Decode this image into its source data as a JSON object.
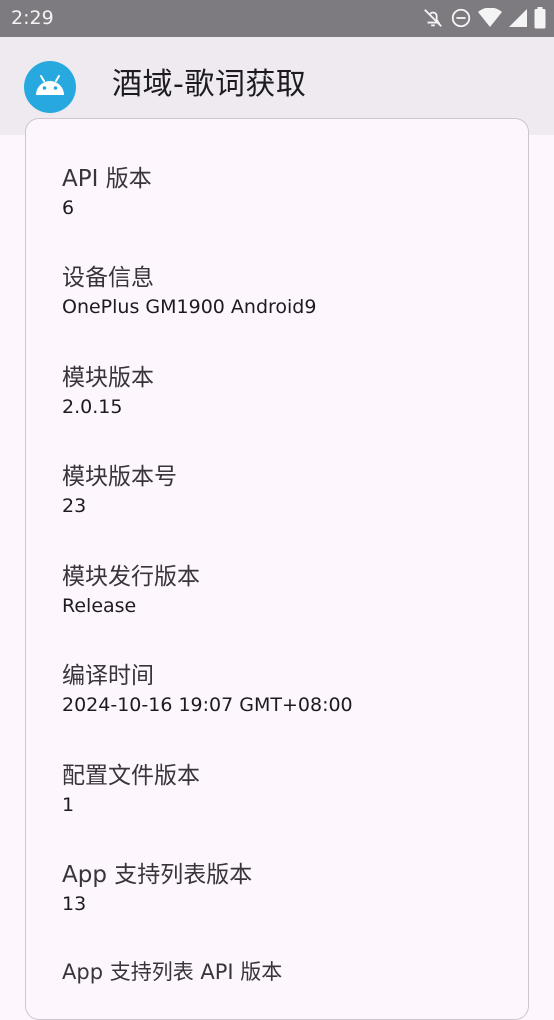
{
  "status_bar": {
    "time": "2:29",
    "icons": [
      "notifications-off-icon",
      "do-not-disturb-icon",
      "wifi-icon",
      "cellular-signal-icon",
      "battery-icon"
    ]
  },
  "app_bar": {
    "title": "酒域-歌词获取",
    "logo_icon": "android-icon",
    "logo_color": "#27a9df"
  },
  "info_items": [
    {
      "label": "API 版本",
      "value": "6"
    },
    {
      "label": "设备信息",
      "value": "OnePlus GM1900 Android9"
    },
    {
      "label": "模块版本",
      "value": "2.0.15"
    },
    {
      "label": "模块版本号",
      "value": "23"
    },
    {
      "label": "模块发行版本",
      "value": "Release"
    },
    {
      "label": "编译时间",
      "value": "2024-10-16 19:07 GMT+08:00"
    },
    {
      "label": "配置文件版本",
      "value": "1"
    },
    {
      "label": "App 支持列表版本",
      "value": "13"
    },
    {
      "label": "App 支持列表 API 版本",
      "value": ""
    }
  ]
}
